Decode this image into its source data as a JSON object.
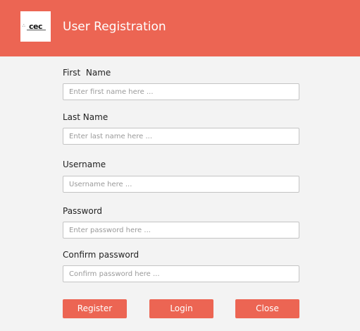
{
  "window": {
    "title": "User Registration",
    "logo_text": "cec",
    "logo_dots": "∴"
  },
  "form": {
    "first_name": {
      "label": "First  Name",
      "placeholder": "Enter first name here ...",
      "value": ""
    },
    "last_name": {
      "label": "Last Name",
      "placeholder": "Enter last name here ...",
      "value": ""
    },
    "username": {
      "label": "Username",
      "placeholder": "Username here ...",
      "value": ""
    },
    "password": {
      "label": "Password",
      "placeholder": "Enter password here ...",
      "value": ""
    },
    "confirm_password": {
      "label": "Confirm password",
      "placeholder": "Confirm password here ...",
      "value": ""
    }
  },
  "buttons": {
    "register_label": "Register",
    "login_label": "Login",
    "close_label": "Close"
  },
  "colors": {
    "accent": "#ec6553",
    "background": "#f3f3f3"
  }
}
